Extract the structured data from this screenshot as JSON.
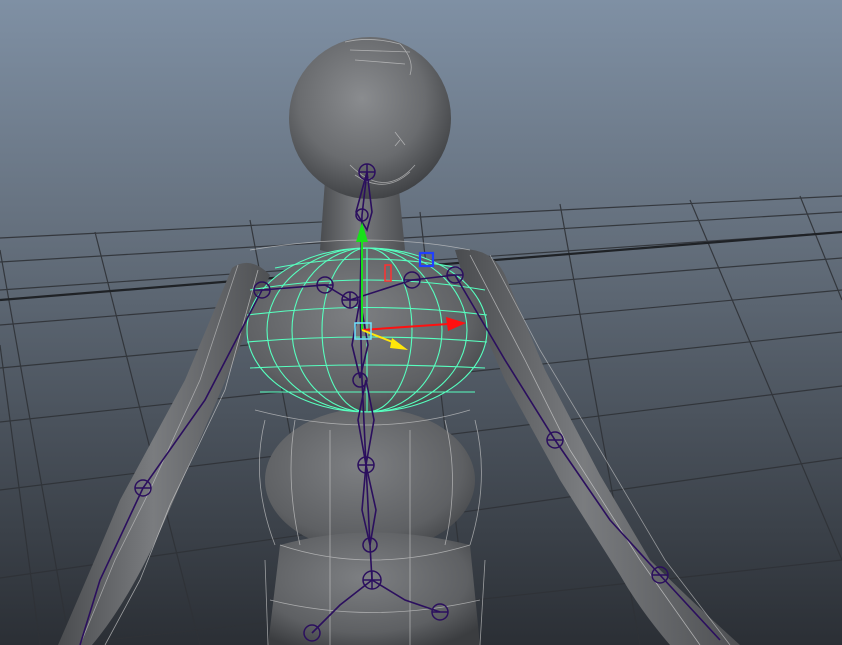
{
  "viewport": {
    "panel": "perspective-viewport",
    "background_top": "#7e8ea2",
    "background_bottom": "#2c3036"
  },
  "scene": {
    "body_color": "#6b6d70",
    "wireframe_color": "#c9c9c9",
    "joint_color": "#2a0f5c",
    "selection_color": "#56ffbf",
    "grid_color": "#2e3136"
  },
  "manipulator": {
    "axis_x_color": "#ff1010",
    "axis_y_color": "#18e01a",
    "axis_z_color": "#ffe60a",
    "plane_handle_color": "#2040ff"
  }
}
